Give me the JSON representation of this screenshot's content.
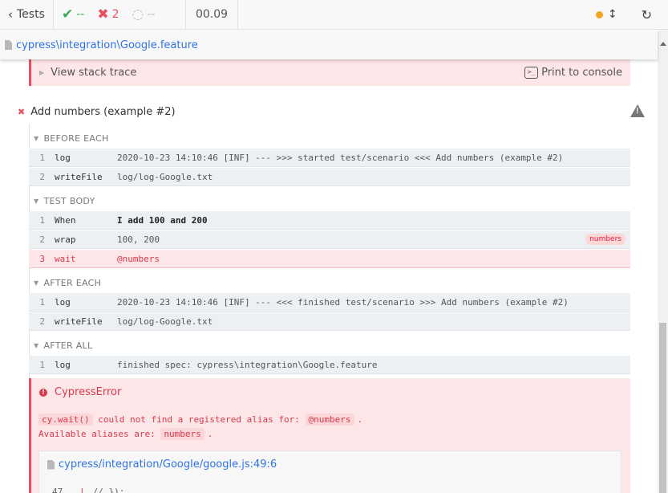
{
  "header": {
    "tests_label": "Tests",
    "passed": "--",
    "failed": "2",
    "pending": "--",
    "duration": "00.09"
  },
  "spec": {
    "path": "cypress\\integration\\Google.feature"
  },
  "stack": {
    "view_label": "View stack trace",
    "print_label": "Print to console",
    "console_icon_text": ">_"
  },
  "test": {
    "title": "Add numbers (example #2)"
  },
  "hooks": [
    {
      "title": "BEFORE EACH",
      "commands": [
        {
          "num": "1",
          "name": "log",
          "message": "2020-10-23 14:10:46 [INF] --- >>> started test/scenario <<< Add numbers (example #2)"
        },
        {
          "num": "2",
          "name": "writeFile",
          "message": "log/log-Google.txt"
        }
      ]
    },
    {
      "title": "TEST BODY",
      "commands": [
        {
          "num": "1",
          "name": "When",
          "message": "I add 100 and 200"
        },
        {
          "num": "2",
          "name": "wrap",
          "message": "100, 200",
          "badge": "numbers"
        },
        {
          "num": "3",
          "name": "wait",
          "message": "@numbers"
        }
      ]
    },
    {
      "title": "AFTER EACH",
      "commands": [
        {
          "num": "1",
          "name": "log",
          "message": "2020-10-23 14:10:46 [INF] --- <<< finished test/scenario >>> Add numbers (example #2)"
        },
        {
          "num": "2",
          "name": "writeFile",
          "message": "log/log-Google.txt"
        }
      ]
    },
    {
      "title": "AFTER ALL",
      "commands": [
        {
          "num": "1",
          "name": "log",
          "message": "finished spec: cypress\\integration\\Google.feature"
        }
      ]
    }
  ],
  "error": {
    "name": "CypressError",
    "code1": "cy.wait()",
    "text1": " could not find a registered alias for: ",
    "code2": "@numbers",
    "text1_end": ".",
    "text2": "Available aliases are: ",
    "code3": "numbers",
    "text2_end": ".",
    "file_link": "cypress/integration/Google/google.js:49:6",
    "code_line_num": "47",
    "code_line_text": "// });"
  },
  "colors": {
    "pass": "#37a957",
    "fail": "#e94f5f",
    "link": "#2e73e6",
    "running_dot": "#f5a623"
  }
}
